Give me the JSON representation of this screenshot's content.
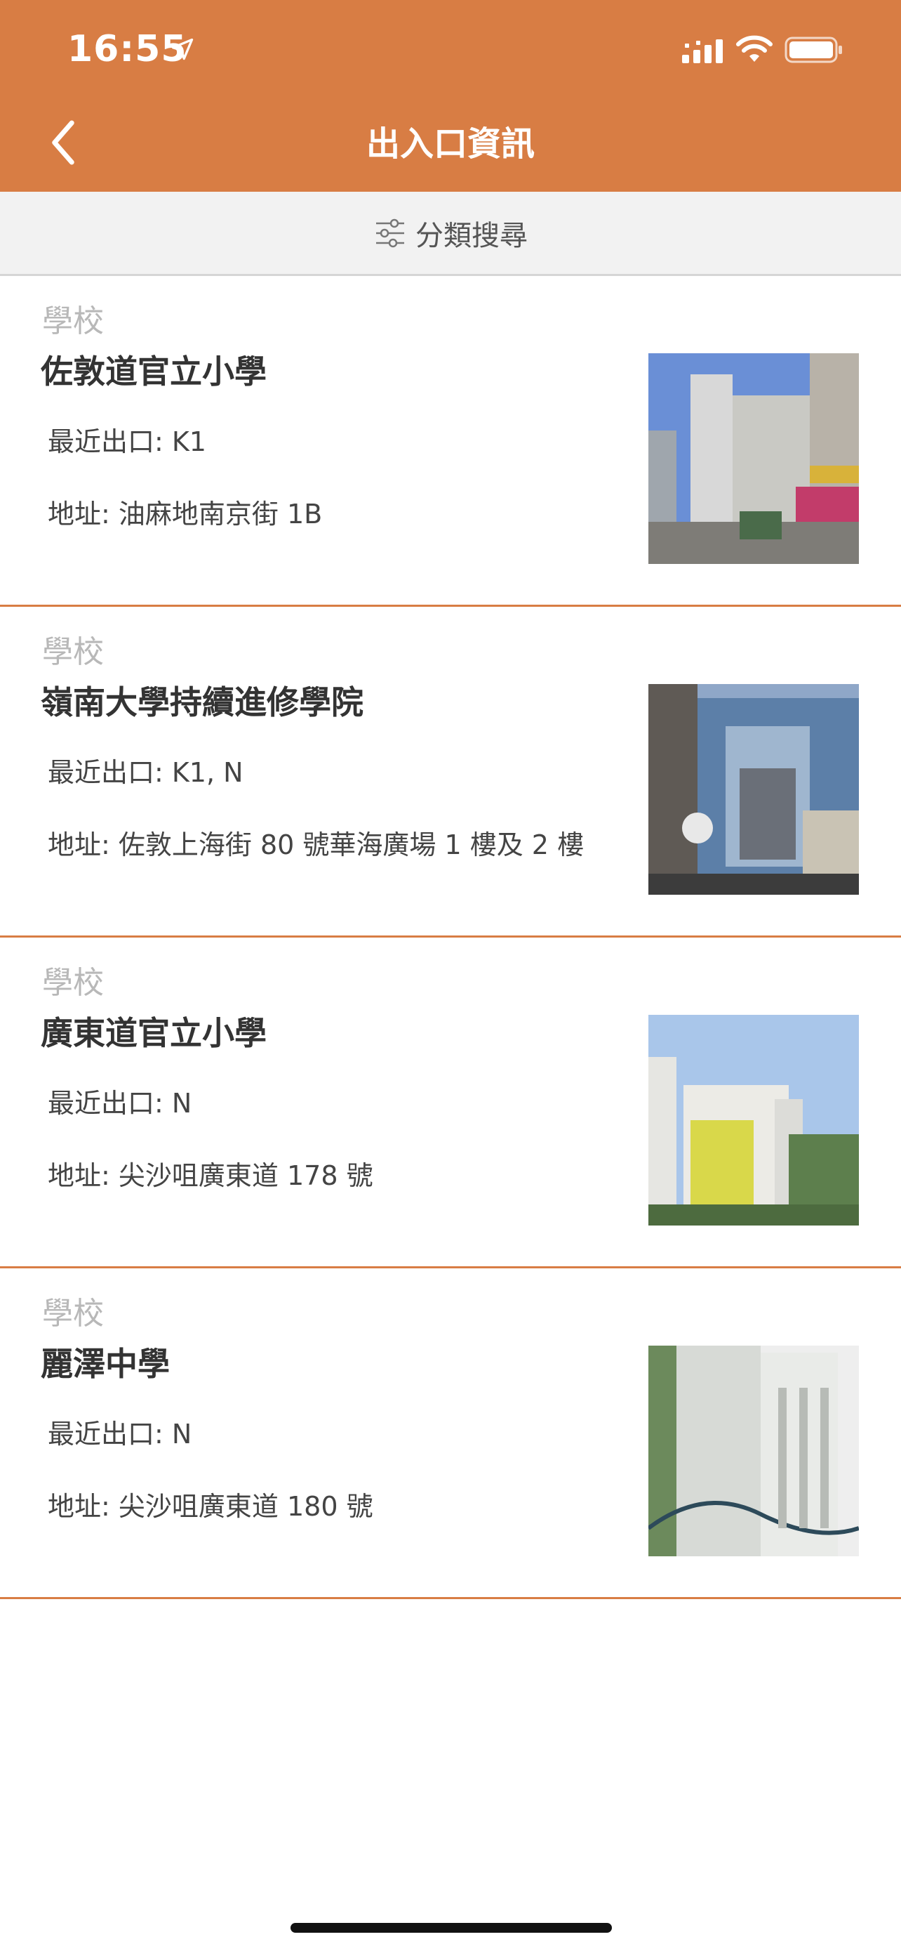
{
  "status_bar": {
    "time": "16:55",
    "icons": [
      "location-arrow-icon",
      "signal-icon",
      "wifi-icon",
      "battery-icon"
    ]
  },
  "nav": {
    "title": "出入口資訊",
    "back_icon": "chevron-left-icon"
  },
  "filter": {
    "label": "分類搜尋",
    "icon": "sliders-icon"
  },
  "colors": {
    "accent": "#d87d44",
    "filter_bg": "#f2f2f2",
    "category_text": "#b8b8b8",
    "name_text": "#333333"
  },
  "items": [
    {
      "category": "學校",
      "name": "佐敦道官立小學",
      "exit": "最近出口: K1",
      "address": "地址: 油麻地南京街 1B"
    },
    {
      "category": "學校",
      "name": "嶺南大學持續進修學院",
      "exit": "最近出口: K1, N",
      "address": "地址: 佐敦上海街 80 號華海廣場 1 樓及 2 樓"
    },
    {
      "category": "學校",
      "name": "廣東道官立小學",
      "exit": "最近出口: N",
      "address": "地址: 尖沙咀廣東道 178 號"
    },
    {
      "category": "學校",
      "name": "麗澤中學",
      "exit": "最近出口: N",
      "address": "地址: 尖沙咀廣東道 180 號"
    }
  ]
}
